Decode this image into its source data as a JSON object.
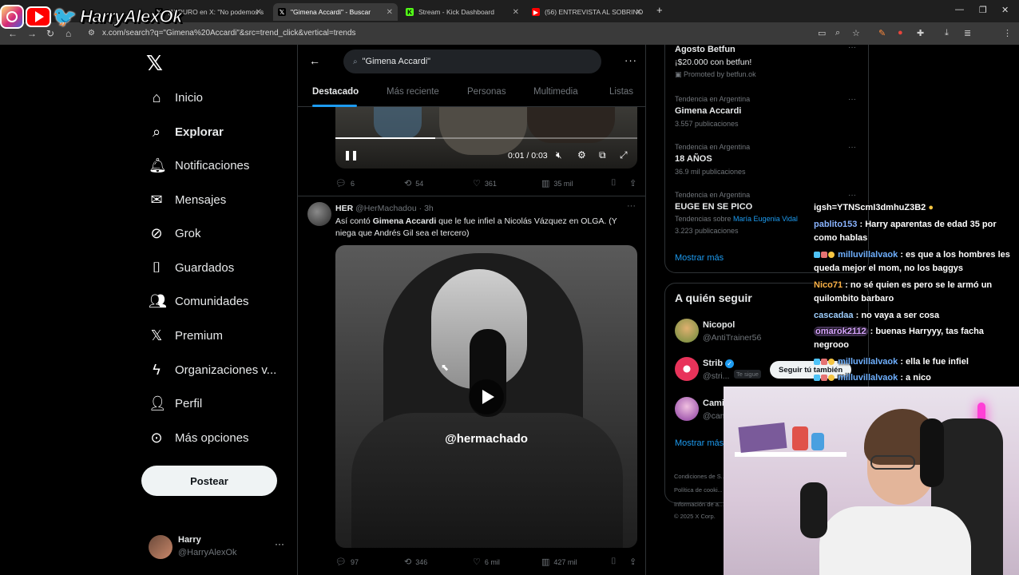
{
  "browser": {
    "tabs": [
      {
        "title": "(1) DURO en X: \"No podemos s",
        "favicon": "x-icon"
      },
      {
        "title": "\"Gimena Accardi\" - Buscar",
        "favicon": "x-icon",
        "active": true
      },
      {
        "title": "Stream - Kick Dashboard",
        "favicon": "kick-icon"
      },
      {
        "title": "(56) ENTREVISTA AL SOBRINO",
        "favicon": "youtube-icon"
      }
    ],
    "url": "x.com/search?q=\"Gimena%20Accardi\"&src=trend_click&vertical=trends"
  },
  "overlay": {
    "channel_name": "HarryAlexOk"
  },
  "sidebar": {
    "items": [
      {
        "label": "Inicio",
        "icon": "home-icon"
      },
      {
        "label": "Explorar",
        "icon": "search-icon",
        "active": true
      },
      {
        "label": "Notificaciones",
        "icon": "bell-icon"
      },
      {
        "label": "Mensajes",
        "icon": "mail-icon"
      },
      {
        "label": "Grok",
        "icon": "grok-icon"
      },
      {
        "label": "Guardados",
        "icon": "bookmark-icon"
      },
      {
        "label": "Comunidades",
        "icon": "people-icon"
      },
      {
        "label": "Premium",
        "icon": "x-icon"
      },
      {
        "label": "Organizaciones v...",
        "icon": "lightning-icon"
      },
      {
        "label": "Perfil",
        "icon": "person-icon"
      },
      {
        "label": "Más opciones",
        "icon": "more-circle-icon"
      }
    ],
    "post_button": "Postear",
    "user": {
      "name": "Harry",
      "handle": "@HarryAlexOk"
    }
  },
  "search": {
    "query": "\"Gimena Accardi\"",
    "tabs": [
      "Destacado",
      "Más reciente",
      "Personas",
      "Multimedia",
      "Listas"
    ]
  },
  "video1": {
    "time": "0:01 / 0:03",
    "progress": 0.33,
    "stats": {
      "replies": "6",
      "reposts": "54",
      "likes": "361",
      "views": "35 mil"
    }
  },
  "post2": {
    "name": "HER",
    "handle": "@HerMachadou",
    "time": "3h",
    "text_prefix": "Así contó ",
    "text_bold": "Gimena Accardi",
    "text_suffix": " que le fue infiel a Nicolás Vázquez en OLGA. (Y niega que Andrés Gil sea el tercero)",
    "watermark": "@hermachado",
    "stats": {
      "replies": "97",
      "reposts": "346",
      "likes": "6 mil",
      "views": "427 mil"
    }
  },
  "trends": {
    "promo": {
      "name": "Agosto Betfun",
      "sub": "¡$20.000 con betfun!",
      "promoted": "Promoted by betfun.ok"
    },
    "items": [
      {
        "label": "Tendencia en Argentina",
        "name": "Gimena Accardi",
        "count": "3.557 publicaciones"
      },
      {
        "label": "Tendencia en Argentina",
        "name": "18 AÑOS",
        "count": "36.9 mil publicaciones"
      },
      {
        "label": "Tendencia en Argentina",
        "name": "EUGE EN SE PICO",
        "related_prefix": "Tendencias sobre ",
        "related": "María Eugenia Vidal",
        "count": "3.223 publicaciones"
      }
    ],
    "show_more": "Mostrar más"
  },
  "who_to_follow": {
    "title": "A quién seguir",
    "accounts": [
      {
        "name": "Nicopol",
        "handle": "@AntiTrainer56"
      },
      {
        "name": "Strib",
        "handle": "@stri...",
        "follows_you": "Te sigue",
        "follow_label": "Seguir tú también"
      },
      {
        "name": "Cami",
        "handle": "@cam..."
      }
    ],
    "show_more": "Mostrar más"
  },
  "footer": {
    "lines": [
      "Condiciones de S...",
      "Política de cooki...",
      "Información de a...",
      "© 2025 X Corp."
    ]
  },
  "chat": {
    "messages": [
      {
        "user": "",
        "text": "igsh=YTNScmI3dmhuZ3B2"
      },
      {
        "user": "pablito153",
        "text": ": Harry aparentas de edad 35 por como hablas"
      },
      {
        "user": "milluvillalvaok",
        "text": ": es que a los hombres les queda mejor el mom, no los baggys"
      },
      {
        "user": "Nico71",
        "text": ": no sé quien es pero se le armó un quilombito barbaro"
      },
      {
        "user": "cascadaa",
        "text": ": no vaya a ser cosa"
      },
      {
        "user": "omarok2112",
        "text": ": buenas Harryyy, tas facha negrooo"
      },
      {
        "user": "milluvillalvaok",
        "text": ": ella le fue infiel"
      },
      {
        "user": "milluvillalvaok",
        "text": ": a nico"
      }
    ],
    "colors": {
      "pablito153": "#8ab4ff",
      "milluvillalvaok": "#6fb0ff",
      "Nico71": "#ffb347",
      "cascadaa": "#9ecfff",
      "omarok2112": "#d9a6ff"
    }
  },
  "colors": {
    "accent": "#1d9bf0",
    "background": "#000000",
    "chrome": "#3a3a3a"
  }
}
